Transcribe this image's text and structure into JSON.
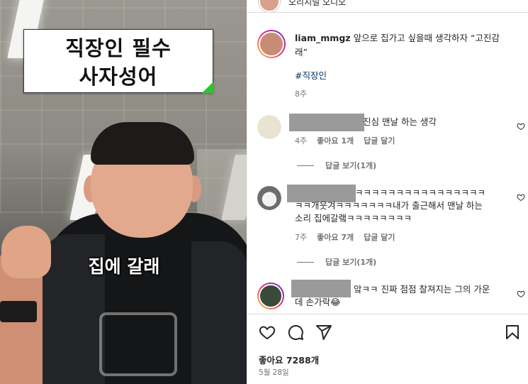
{
  "video": {
    "caption_line1": "직장인 필수",
    "caption_line2": "사자성어",
    "subtitle": "집에 갈래"
  },
  "audio": {
    "label": "오리지널 오디오"
  },
  "post": {
    "username": "liam_mmgz",
    "caption": "앞으로 집가고 싶을때 생각하자 “고진감래”",
    "hashtag": "#직장인",
    "age": "8주"
  },
  "comments": [
    {
      "text": "진심 맨날 하는 생각",
      "age": "4주",
      "likes": "좋아요 1개",
      "reply": "답글 달기",
      "view_replies": "답글 보기(1개)"
    },
    {
      "text_line1": "ㅋㅋㅋㅋㅋㅋㅋㅋㅋㅋㅋㅋㅋㅋㅋㅋ",
      "text_line2": "ㅋㅋ개웃겨ㅋㅋㅋㅋㅋㅋㅋ내가 출근해서 맨날 하는",
      "text_line3": "소리 집에갈랰ㅋㅋㅋㅋㅋㅋㅋㅋ",
      "age": "7주",
      "likes": "좋아요 7개",
      "reply": "답글 달기",
      "view_replies": "답글 보기(1개)"
    },
    {
      "text_line1": "앜ㅋㅋ 진짜 점점 찰져지는 그의 가운",
      "text_line2": "데 손가락😂"
    }
  ],
  "footer": {
    "likes": "좋아요 7288개",
    "date": "5월 28일"
  },
  "icons": [
    "heart-icon",
    "comment-icon",
    "share-icon",
    "bookmark-icon"
  ]
}
